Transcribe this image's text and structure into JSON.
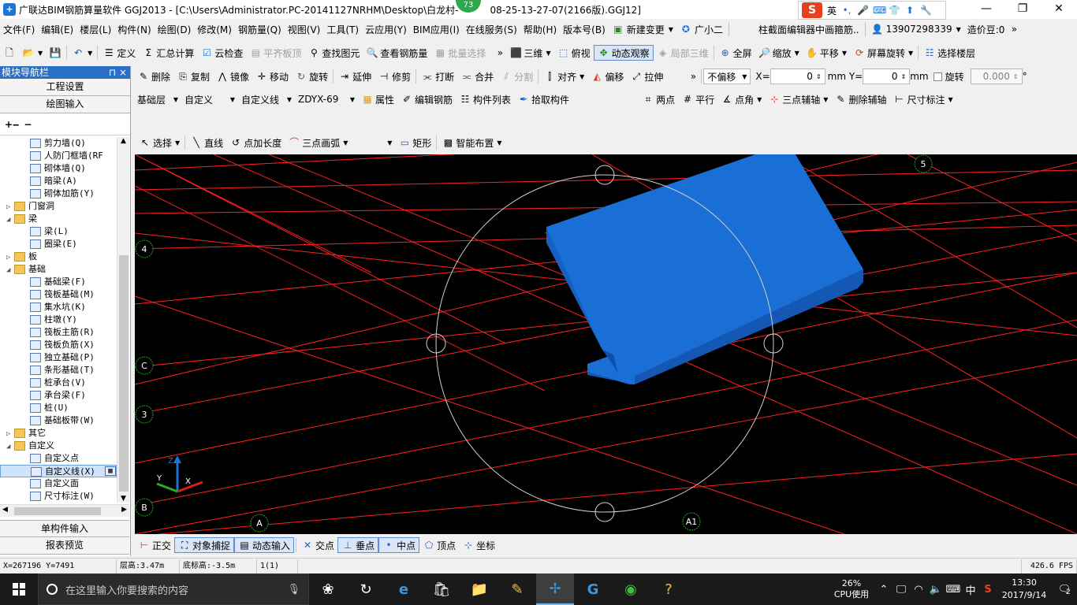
{
  "window": {
    "title": "广联达BIM钢筋算量软件 GGJ2013 - [C:\\Users\\Administrator.PC-20141127NRHM\\Desktop\\白龙村-",
    "title_suffix": "08-25-13-27-07(2166版).GGJ12]",
    "badge": "73",
    "ime_label": "英",
    "minimize": "—",
    "maximize": "❐",
    "close": "✕"
  },
  "menu": [
    "文件(F)",
    "编辑(E)",
    "楼层(L)",
    "构件(N)",
    "绘图(D)",
    "修改(M)",
    "钢筋量(Q)",
    "视图(V)",
    "工具(T)",
    "云应用(Y)",
    "BIM应用(I)",
    "在线服务(S)",
    "帮助(H)",
    "版本号(B)"
  ],
  "menu_extra": {
    "new_change": "新建变更",
    "guangxiaoer": "广小二",
    "notice": "柱截面编辑器中画箍筋..",
    "phone": "13907298339",
    "zaojiadou": "造价豆:0"
  },
  "toolbar1": {
    "define": "定义",
    "sum_calc": "汇总计算",
    "cloud_check": "云检查",
    "flat_top": "平齐板顶",
    "find_elem": "查找图元",
    "view_rebar": "查看钢筋量",
    "batch_select": "批量选择",
    "three_d": "三维",
    "top_view": "俯视",
    "dynamic_view": "动态观察",
    "local_3d": "局部三维",
    "fullscreen": "全屏",
    "zoom": "缩放",
    "pan": "平移",
    "screen_rotate": "屏幕旋转",
    "select_floor": "选择楼层"
  },
  "toolbar2": {
    "delete": "删除",
    "copy": "复制",
    "mirror": "镜像",
    "move": "移动",
    "rotate": "旋转",
    "extend": "延伸",
    "trim": "修剪",
    "break": "打断",
    "merge": "合并",
    "split": "分割",
    "align": "对齐",
    "offset": "偏移",
    "stretch": "拉伸",
    "no_offset": "不偏移",
    "x_label": "X=",
    "x_value": "0",
    "y_label": "mm Y=",
    "y_value": "0",
    "mm": "mm",
    "rotate_label": "旋转",
    "rotate_value": "0.000",
    "deg": "°"
  },
  "toolbar3": {
    "floor": "基础层",
    "category": "自定义",
    "type": "自定义线",
    "name": "ZDYX-69",
    "property": "属性",
    "edit_rebar": "编辑钢筋",
    "comp_list": "构件列表",
    "pick_comp": "拾取构件",
    "two_points": "两点",
    "parallel": "平行",
    "point_angle": "点角",
    "three_point_axis": "三点辅轴",
    "delete_axis": "删除辅轴",
    "dim": "尺寸标注"
  },
  "toolbar4": {
    "select": "选择",
    "line": "直线",
    "point_length": "点加长度",
    "three_point_arc": "三点画弧",
    "rect": "矩形",
    "smart_place": "智能布置"
  },
  "nav": {
    "title": "模块导航栏",
    "pin": "⊓ ×",
    "project_settings": "工程设置",
    "drawing_input": "绘图输入",
    "single_input": "单构件输入",
    "report": "报表预览",
    "tree": [
      {
        "level": 2,
        "label": "剪力墙(Q)",
        "type": "leaf"
      },
      {
        "level": 2,
        "label": "人防门框墙(RF",
        "type": "leaf"
      },
      {
        "level": 2,
        "label": "砌体墙(Q)",
        "type": "leaf"
      },
      {
        "level": 2,
        "label": "暗梁(A)",
        "type": "leaf"
      },
      {
        "level": 2,
        "label": "砌体加筋(Y)",
        "type": "leaf"
      },
      {
        "level": 1,
        "label": "门窗洞",
        "type": "folder",
        "exp": "▷"
      },
      {
        "level": 1,
        "label": "梁",
        "type": "folder",
        "exp": "◢"
      },
      {
        "level": 2,
        "label": "梁(L)",
        "type": "leaf"
      },
      {
        "level": 2,
        "label": "圈梁(E)",
        "type": "leaf"
      },
      {
        "level": 1,
        "label": "板",
        "type": "folder",
        "exp": "▷"
      },
      {
        "level": 1,
        "label": "基础",
        "type": "folder",
        "exp": "◢"
      },
      {
        "level": 2,
        "label": "基础梁(F)",
        "type": "leaf"
      },
      {
        "level": 2,
        "label": "筏板基础(M)",
        "type": "leaf"
      },
      {
        "level": 2,
        "label": "集水坑(K)",
        "type": "leaf"
      },
      {
        "level": 2,
        "label": "柱墩(Y)",
        "type": "leaf"
      },
      {
        "level": 2,
        "label": "筏板主筋(R)",
        "type": "leaf"
      },
      {
        "level": 2,
        "label": "筏板负筋(X)",
        "type": "leaf"
      },
      {
        "level": 2,
        "label": "独立基础(P)",
        "type": "leaf"
      },
      {
        "level": 2,
        "label": "条形基础(T)",
        "type": "leaf"
      },
      {
        "level": 2,
        "label": "桩承台(V)",
        "type": "leaf"
      },
      {
        "level": 2,
        "label": "承台梁(F)",
        "type": "leaf"
      },
      {
        "level": 2,
        "label": "桩(U)",
        "type": "leaf"
      },
      {
        "level": 2,
        "label": "基础板带(W)",
        "type": "leaf"
      },
      {
        "level": 1,
        "label": "其它",
        "type": "folder",
        "exp": "▷"
      },
      {
        "level": 1,
        "label": "自定义",
        "type": "folder",
        "exp": "◢"
      },
      {
        "level": 2,
        "label": "自定义点",
        "type": "leaf"
      },
      {
        "level": 2,
        "label": "自定义线(X)",
        "type": "leaf",
        "selected": true
      },
      {
        "level": 2,
        "label": "自定义面",
        "type": "leaf"
      },
      {
        "level": 2,
        "label": "尺寸标注(W)",
        "type": "leaf"
      }
    ]
  },
  "viewport": {
    "axis_labels": [
      "5",
      "4",
      "C",
      "3",
      "B",
      "A",
      "A1"
    ],
    "gizmo": {
      "x": "X",
      "y": "Y",
      "z": "Z"
    },
    "colors": {
      "grid": "#ff2020",
      "slab": "#1a6fd6",
      "orbit": "#d0d0d0",
      "axis_bubble": "#22a822"
    }
  },
  "snapbar": {
    "ortho": "正交",
    "snap": "对象捕捉",
    "dyn_input": "动态输入",
    "intersection": "交点",
    "perpendicular": "垂点",
    "midpoint": "中点",
    "vertex": "顶点",
    "coordinate": "坐标"
  },
  "status": {
    "coords": "X=267196 Y=7491",
    "floor_height": "层高:3.47m",
    "bottom_elev": "底标高:-3.5m",
    "count": "1(1)",
    "fps": "426.6 FPS"
  },
  "taskbar": {
    "search_placeholder": "在这里输入你要搜索的内容",
    "cpu_percent": "26%",
    "cpu_label": "CPU使用",
    "ime_cn": "中",
    "time": "13:30",
    "date": "2017/9/14",
    "notif_count": "2"
  }
}
